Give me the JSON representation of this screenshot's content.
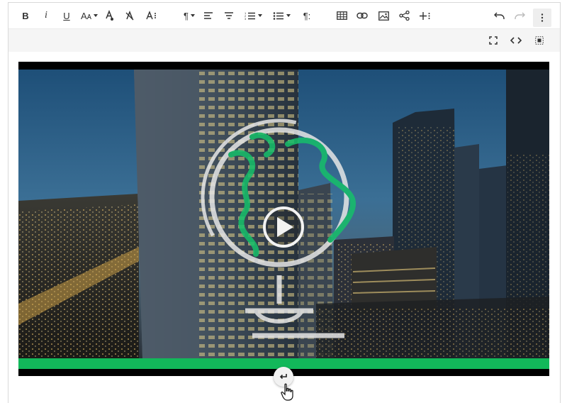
{
  "toolbar": {
    "bold": "B",
    "italic": "i",
    "underline": "U",
    "font_size": "Aᴀ",
    "text_color_icon": "text-color-icon",
    "clear_format_icon": "clear-formatting-icon",
    "more_text_icon": "more-text-icon",
    "paragraph_format": "¶",
    "align_icon": "align-left-icon",
    "more_paragraph_icon": "more-paragraph-icon",
    "ordered_list_icon": "ordered-list-icon",
    "unordered_list_icon": "unordered-list-icon",
    "paragraph_style": "¶:",
    "table_icon": "table-icon",
    "link_icon": "link-icon",
    "image_icon": "image-icon",
    "share_icon": "share-icon",
    "insert_more_icon": "insert-more-icon",
    "undo_icon": "undo-icon",
    "redo_icon": "redo-icon",
    "more_icon": "more-vertical-icon"
  },
  "subbar": {
    "fullscreen_icon": "fullscreen-icon",
    "code_view_icon": "code-view-icon",
    "select_all_icon": "select-all-icon"
  },
  "video": {
    "play_icon": "play-icon",
    "globe_icon": "globe-icon",
    "progress_color": "#12b85a",
    "insert_after_icon": "enter-icon"
  },
  "colors": {
    "accent_green": "#12b85a",
    "toolbar_bg": "#ffffff",
    "subbar_bg": "#f5f5f5"
  }
}
